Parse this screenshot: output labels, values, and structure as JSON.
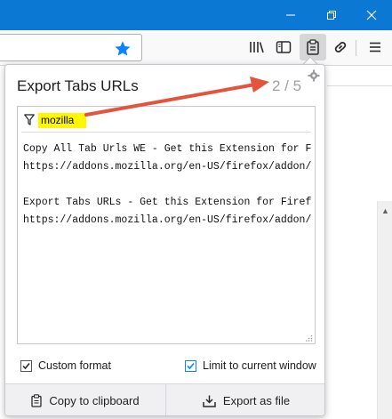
{
  "popup": {
    "title": "Export Tabs URLs",
    "counter": "2 / 5",
    "filter_value": "mozilla",
    "urls_text": "Copy All Tab Urls WE - Get this Extension for Firefox\nhttps://addons.mozilla.org/en-US/firefox/addon/copy-all-tab-urls-we/\n\nExport Tabs URLs - Get this Extension for Firefox\nhttps://addons.mozilla.org/en-US/firefox/addon/export-tabs-urls-and-titles/",
    "options": {
      "custom_format_label": "Custom format",
      "custom_format_checked": true,
      "limit_window_label": "Limit to current window",
      "limit_window_checked": true
    },
    "footer": {
      "copy_label": "Copy to clipboard",
      "export_label": "Export as file"
    }
  },
  "toolbar": {
    "icons": [
      "star-icon",
      "library-icon",
      "sidebar-icon",
      "extension-clipboard-icon",
      "link-icon",
      "menu-icon"
    ]
  },
  "window": {
    "controls": [
      "minimize-icon",
      "maximize-icon",
      "close-icon"
    ]
  },
  "colors": {
    "titlebar": "#0b78d4",
    "accent": "#0a84ff",
    "highlight": "#fff700",
    "annotation": "#e4533c"
  }
}
